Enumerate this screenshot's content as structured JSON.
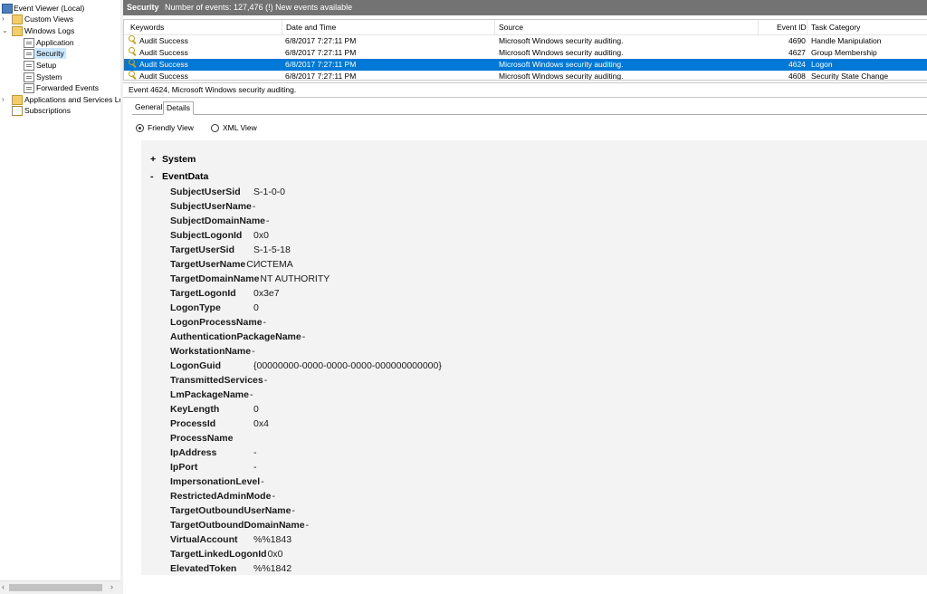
{
  "tree": {
    "root": "Event Viewer (Local)",
    "custom_views": "Custom Views",
    "windows_logs": "Windows Logs",
    "application": "Application",
    "security": "Security",
    "setup": "Setup",
    "system": "System",
    "forwarded": "Forwarded Events",
    "apps_services": "Applications and Services Lo",
    "subscriptions": "Subscriptions"
  },
  "header": {
    "title": "Security",
    "status": "Number of events: 127,476 (!) New events available"
  },
  "grid": {
    "columns": [
      "Keywords",
      "Date and Time",
      "Source",
      "Event ID",
      "Task Category"
    ],
    "rows": [
      {
        "keywords": "Audit Success",
        "datetime": "6/8/2017 7:27:11 PM",
        "source": "Microsoft Windows security auditing.",
        "event_id": "4690",
        "task": "Handle Manipulation"
      },
      {
        "keywords": "Audit Success",
        "datetime": "6/8/2017 7:27:11 PM",
        "source": "Microsoft Windows security auditing.",
        "event_id": "4627",
        "task": "Group Membership"
      },
      {
        "keywords": "Audit Success",
        "datetime": "6/8/2017 7:27:11 PM",
        "source": "Microsoft Windows security auditing.",
        "event_id": "4624",
        "task": "Logon"
      },
      {
        "keywords": "Audit Success",
        "datetime": "6/8/2017 7:27:11 PM",
        "source": "Microsoft Windows security auditing.",
        "event_id": "4608",
        "task": "Security State Change"
      }
    ]
  },
  "detail": {
    "header": "Event 4624, Microsoft Windows security auditing.",
    "tabs": [
      "General",
      "Details"
    ],
    "friendly_view": "Friendly View",
    "xml_view": "XML View",
    "system_toggle": "+",
    "system_label": "System",
    "eventdata_toggle": "-",
    "eventdata_label": "EventData",
    "fields": [
      {
        "k": "SubjectUserSid",
        "v": "S-1-0-0"
      },
      {
        "k": "SubjectUserName",
        "v": "-"
      },
      {
        "k": "SubjectDomainName",
        "v": "-"
      },
      {
        "k": "SubjectLogonId",
        "v": "0x0"
      },
      {
        "k": "TargetUserSid",
        "v": "S-1-5-18"
      },
      {
        "k": "TargetUserName",
        "v": "СИСТЕМА"
      },
      {
        "k": "TargetDomainName",
        "v": "NT AUTHORITY"
      },
      {
        "k": "TargetLogonId",
        "v": "0x3e7"
      },
      {
        "k": "LogonType",
        "v": "0"
      },
      {
        "k": "LogonProcessName",
        "v": "-"
      },
      {
        "k": "AuthenticationPackageName",
        "v": "-"
      },
      {
        "k": "WorkstationName",
        "v": "-"
      },
      {
        "k": "LogonGuid",
        "v": "{00000000-0000-0000-0000-000000000000}"
      },
      {
        "k": "TransmittedServices",
        "v": "-"
      },
      {
        "k": "LmPackageName",
        "v": "-"
      },
      {
        "k": "KeyLength",
        "v": "0"
      },
      {
        "k": "ProcessId",
        "v": "0x4"
      },
      {
        "k": "ProcessName",
        "v": ""
      },
      {
        "k": "IpAddress",
        "v": "-"
      },
      {
        "k": "IpPort",
        "v": "-"
      },
      {
        "k": "ImpersonationLevel",
        "v": "-"
      },
      {
        "k": "RestrictedAdminMode",
        "v": "-"
      },
      {
        "k": "TargetOutboundUserName",
        "v": "-"
      },
      {
        "k": "TargetOutboundDomainName",
        "v": "-"
      },
      {
        "k": "VirtualAccount",
        "v": "%%1843"
      },
      {
        "k": "TargetLinkedLogonId",
        "v": "0x0"
      },
      {
        "k": "ElevatedToken",
        "v": "%%1842"
      }
    ]
  },
  "colors": {
    "selection": "#0078d7",
    "titlebar": "#737373",
    "tree_selection": "#cce8ff"
  }
}
